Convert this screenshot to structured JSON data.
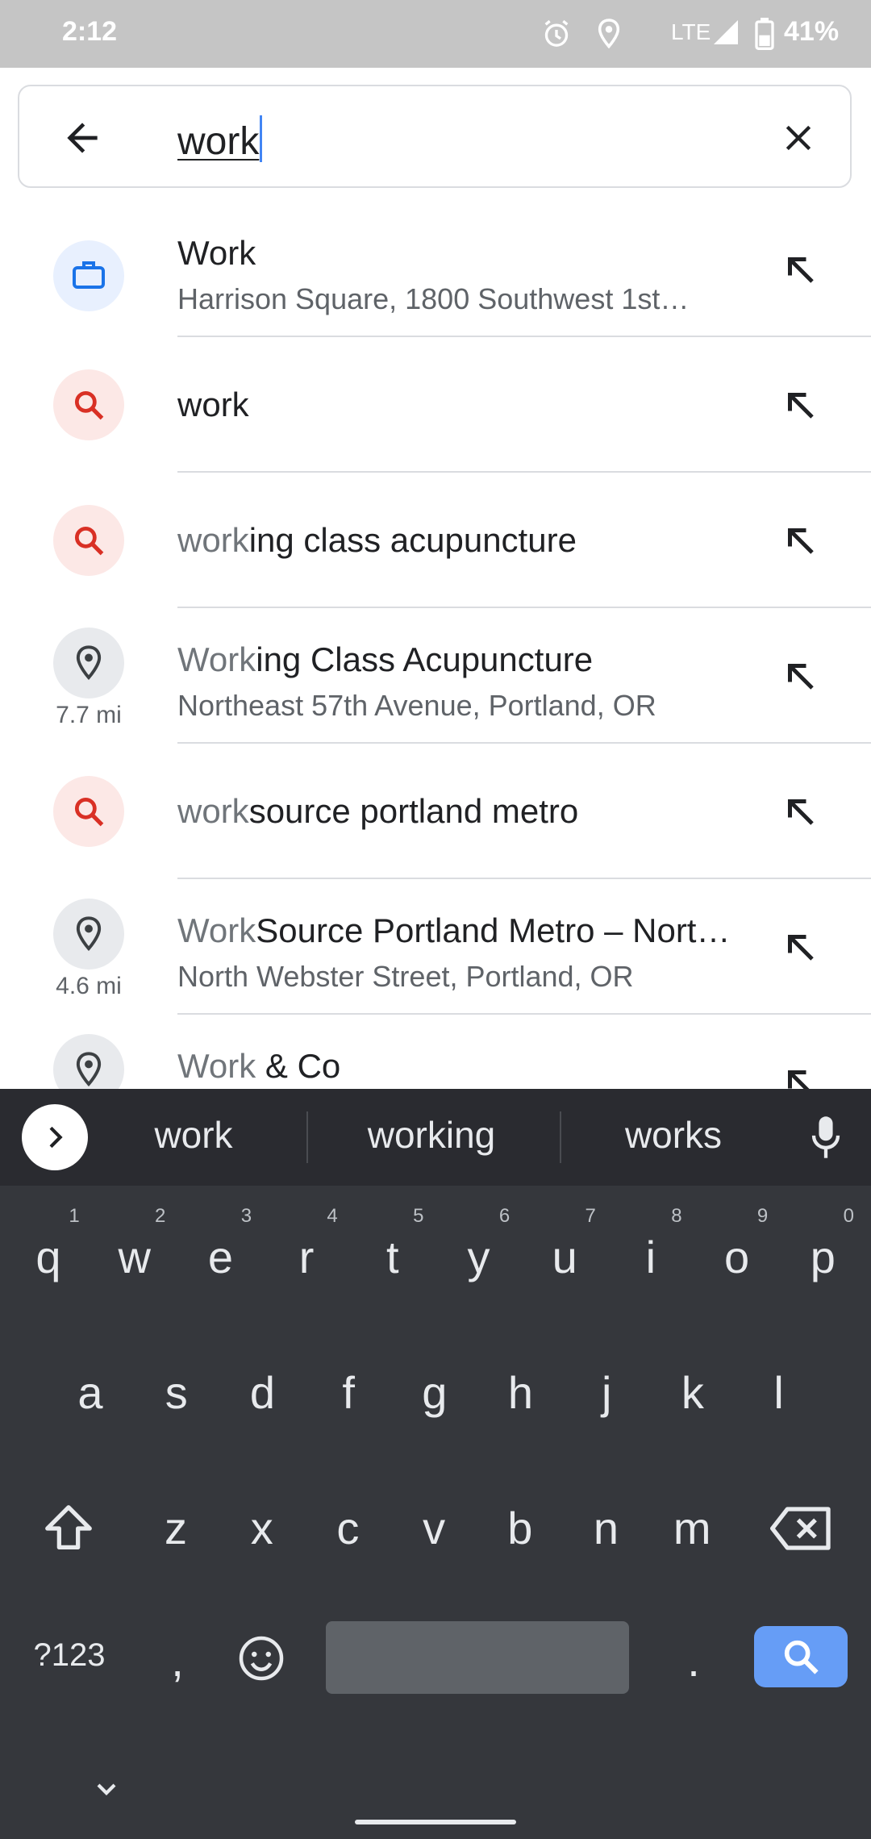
{
  "status_bar": {
    "time": "2:12",
    "network": "LTE",
    "battery": "41%"
  },
  "search": {
    "query": "work"
  },
  "results": [
    {
      "type": "work",
      "icon": "briefcase-icon",
      "title_match": "Work",
      "title_rest": "",
      "subtitle": "Harrison Square, 1800 Southwest 1st…",
      "distance": ""
    },
    {
      "type": "query",
      "icon": "search-icon",
      "title_match": "",
      "title_rest": "work",
      "subtitle": "",
      "distance": ""
    },
    {
      "type": "query",
      "icon": "search-icon",
      "title_match": "work",
      "title_rest": "ing class acupuncture",
      "subtitle": "",
      "distance": ""
    },
    {
      "type": "place",
      "icon": "place-icon",
      "title_match": "Work",
      "title_rest": "ing Class Acupuncture",
      "subtitle": "Northeast 57th Avenue, Portland, OR",
      "distance": "7.7 mi"
    },
    {
      "type": "query",
      "icon": "search-icon",
      "title_match": "work",
      "title_rest": "source portland metro",
      "subtitle": "",
      "distance": ""
    },
    {
      "type": "place",
      "icon": "place-icon",
      "title_match": "Work",
      "title_rest": "Source Portland Metro – Nort…",
      "subtitle": "North Webster Street, Portland, OR",
      "distance": "4.6 mi"
    },
    {
      "type": "place",
      "icon": "place-icon",
      "title_match": "Work",
      "title_rest": " & Co",
      "subtitle": "",
      "distance": ""
    }
  ],
  "keyboard": {
    "suggestions": [
      "work",
      "working",
      "works"
    ],
    "row1": [
      "q",
      "w",
      "e",
      "r",
      "t",
      "y",
      "u",
      "i",
      "o",
      "p"
    ],
    "row1_hints": [
      "1",
      "2",
      "3",
      "4",
      "5",
      "6",
      "7",
      "8",
      "9",
      "0"
    ],
    "row2": [
      "a",
      "s",
      "d",
      "f",
      "g",
      "h",
      "j",
      "k",
      "l"
    ],
    "row3": [
      "z",
      "x",
      "c",
      "v",
      "b",
      "n",
      "m"
    ],
    "symbols_label": "?123",
    "comma": ",",
    "period": "."
  },
  "colors": {
    "accent": "#4285f4",
    "search_icon_red": "#d93025",
    "work_icon_blue": "#1a73e8"
  }
}
